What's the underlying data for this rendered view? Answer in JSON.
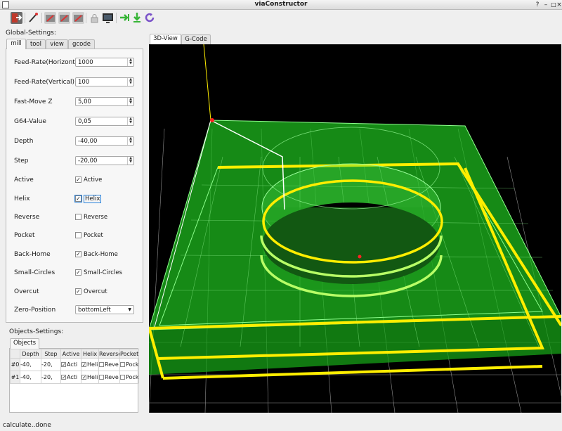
{
  "window": {
    "title": "viaConstructor"
  },
  "global_settings": {
    "heading": "Global-Settings:",
    "tabs": [
      "mill",
      "tool",
      "view",
      "gcode"
    ],
    "fields": [
      {
        "label": "Feed-Rate(Horizontal)",
        "value": "1000"
      },
      {
        "label": "Feed-Rate(Vertical)",
        "value": "100"
      },
      {
        "label": "Fast-Move Z",
        "value": "5,00"
      },
      {
        "label": "G64-Value",
        "value": "0,05"
      },
      {
        "label": "Depth",
        "value": "-40,00"
      },
      {
        "label": "Step",
        "value": "-20,00"
      }
    ],
    "checks": [
      {
        "label": "Active",
        "text": "Active",
        "checked": true
      },
      {
        "label": "Helix",
        "text": "Helix",
        "checked": true
      },
      {
        "label": "Reverse",
        "text": "Reverse",
        "checked": false
      },
      {
        "label": "Pocket",
        "text": "Pocket",
        "checked": false
      },
      {
        "label": "Back-Home",
        "text": "Back-Home",
        "checked": true
      },
      {
        "label": "Small-Circles",
        "text": "Small-Circles",
        "checked": true
      },
      {
        "label": "Overcut",
        "text": "Overcut",
        "checked": true
      }
    ],
    "zero_position": {
      "label": "Zero-Position",
      "value": "bottomLeft"
    }
  },
  "objects_settings": {
    "heading": "Objects-Settings:",
    "tab": "Objects",
    "columns": [
      "Depth",
      "Step",
      "Active",
      "Helix",
      "Reverse",
      "Pocket"
    ],
    "rows": [
      {
        "id": "#0",
        "depth": "-40,",
        "step": "-20,",
        "active": "Acti",
        "helix": "Heli",
        "reverse": "Reve",
        "pocket": "Pock"
      },
      {
        "id": "#1",
        "depth": "-40,",
        "step": "-20,",
        "active": "Acti",
        "helix": "Heli",
        "reverse": "Reve",
        "pocket": "Pock"
      }
    ]
  },
  "view_tabs": [
    "3D-View",
    "G-Code"
  ],
  "status": "calculate..done",
  "icons": [
    "exit-icon",
    "settings-wand-icon",
    "load-icon",
    "save-icon",
    "save-as-icon",
    "lock-icon",
    "monitor-icon",
    "next-icon",
    "download-icon",
    "refresh-icon"
  ],
  "colors": {
    "background_3d": "#000000",
    "plate": "#2ee62e",
    "toolpath": "#ffff00",
    "grid": "#9a9a9a"
  }
}
